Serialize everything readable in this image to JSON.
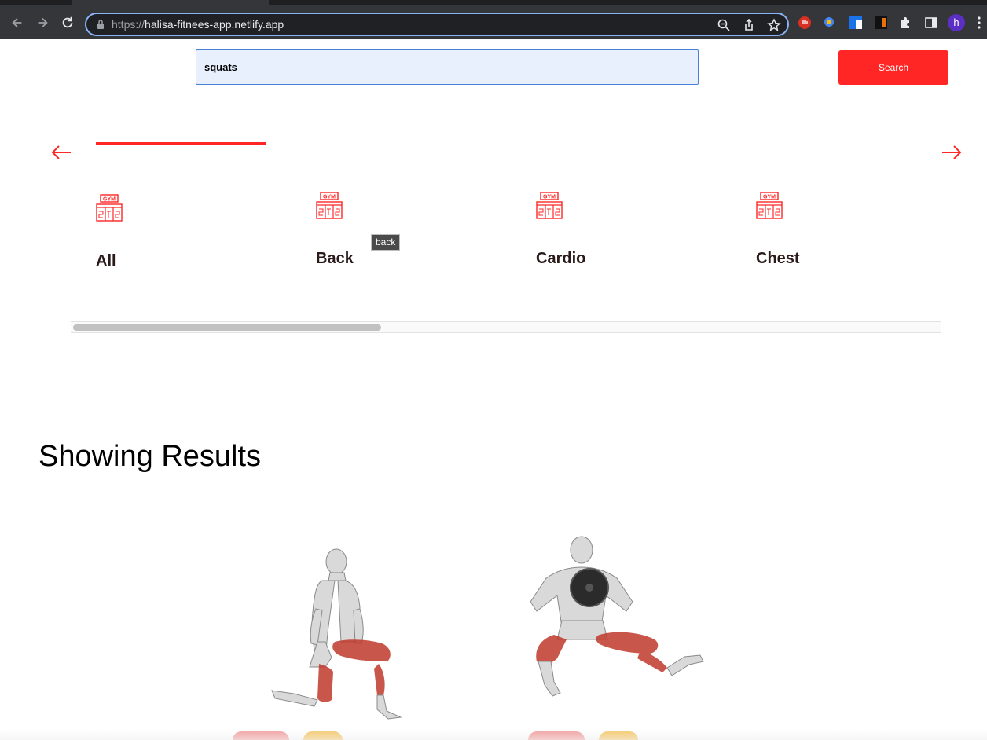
{
  "browser": {
    "url_scheme": "https://",
    "url_host": "halisa-fitnees-app.netlify.app",
    "profile_initial": "h"
  },
  "search": {
    "value": "squats",
    "button_label": "Search"
  },
  "categories": [
    {
      "label": "All",
      "icon": "gym-icon"
    },
    {
      "label": "Back",
      "icon": "gym-icon"
    },
    {
      "label": "Cardio",
      "icon": "gym-icon"
    },
    {
      "label": "Chest",
      "icon": "gym-icon"
    }
  ],
  "tooltip": "back",
  "results": {
    "title": "Showing Results",
    "cards": [
      {
        "image": "kneeling-lunge-figure"
      },
      {
        "image": "side-squat-plate-figure"
      }
    ]
  },
  "colors": {
    "accent": "#ff2625",
    "pill_red": "#f4a0a0",
    "pill_yellow": "#f5c96a"
  }
}
